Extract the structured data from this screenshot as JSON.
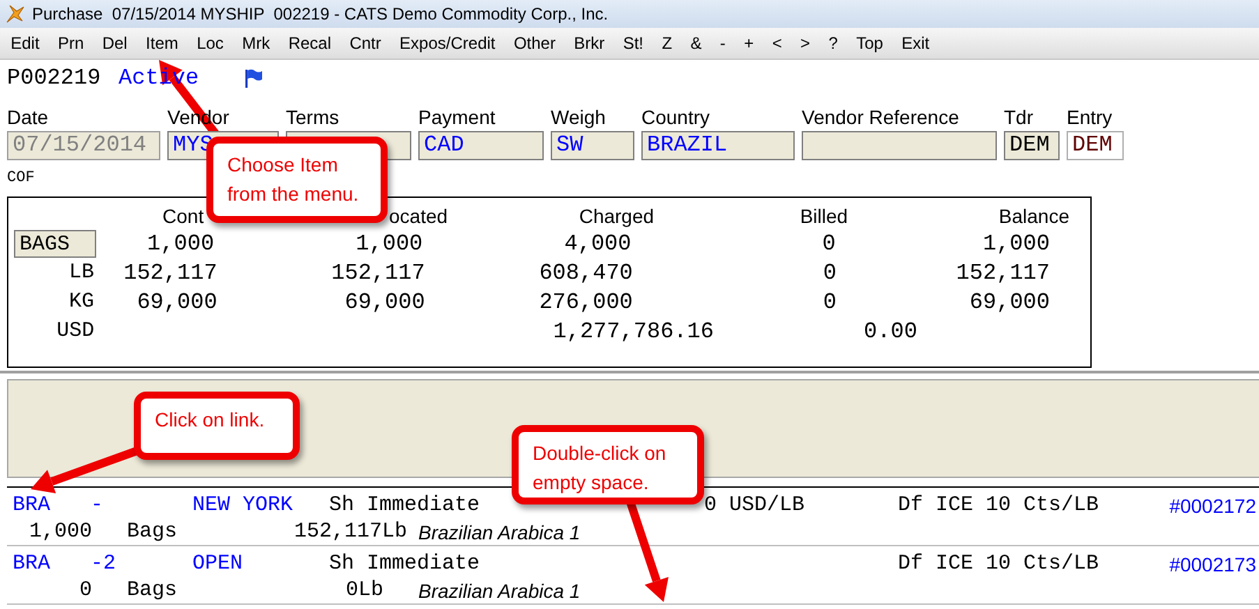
{
  "window": {
    "title": "Purchase  07/15/2014 MYSHIP  002219 - CATS Demo Commodity Corp., Inc."
  },
  "menu": [
    "Edit",
    "Prn",
    "Del",
    "Item",
    "Loc",
    "Mrk",
    "Recal",
    "Cntr",
    "Expos/Credit",
    "Other",
    "Brkr",
    "St!",
    "Z",
    "&",
    "-",
    "+",
    "<",
    ">",
    "?",
    "Top",
    "Exit"
  ],
  "header": {
    "id": "P002219",
    "status": "Active"
  },
  "fields": [
    {
      "label": "Date",
      "value": "07/15/2014",
      "kind": "disabled"
    },
    {
      "label": "Vendor",
      "value": "MYS",
      "kind": "lookup"
    },
    {
      "label": "Terms",
      "kind": "readonly"
    },
    {
      "label": "Payment",
      "value": "CAD",
      "kind": "lookup"
    },
    {
      "label": "Weigh",
      "value": "SW",
      "kind": "lookup"
    },
    {
      "label": "Country",
      "value": "BRAZIL",
      "kind": "lookup"
    },
    {
      "label": "Vendor Reference",
      "kind": "readonly"
    },
    {
      "label": "Tdr",
      "value": "DEM",
      "kind": "readonly"
    },
    {
      "label": "Entry",
      "value": "DEM",
      "kind": "editable"
    }
  ],
  "commodity": "COF",
  "summary": {
    "columns": [
      "Cont",
      "ocated",
      "Charged",
      "Billed",
      "Balance"
    ],
    "rows": [
      {
        "unit": "BAGS",
        "kind": "field",
        "values": {
          "column_1": "1,000",
          "column_2": "1,000",
          "column_3": "4,000",
          "column_4": "0",
          "column_5": "1,000"
        }
      },
      {
        "unit": "LB",
        "kind": "text",
        "values": {
          "column_1": "152,117",
          "column_2": "152,117",
          "column_3": "608,470",
          "column_4": "0",
          "column_5": "152,117"
        }
      },
      {
        "unit": "KG",
        "kind": "text",
        "values": {
          "column_1": "69,000",
          "column_2": "69,000",
          "column_3": "276,000",
          "column_4": "0",
          "column_5": "69,000"
        }
      },
      {
        "unit": "USD",
        "kind": "text",
        "values": {
          "column_3": "1,277,786.16",
          "column_4": "0.00"
        }
      }
    ]
  },
  "items": [
    {
      "grade": "BRA",
      "suffix": "-",
      "location": "NEW YORK",
      "ship": "Sh",
      "timing": "Immediate",
      "price": "0 USD/LB",
      "futures": "Df ICE 10 Cts/LB",
      "number": "#0002172",
      "quantity": "1,000",
      "unit": "Bags",
      "weight": "152,117Lb",
      "description": "Brazilian Arabica 1"
    },
    {
      "grade": "BRA",
      "suffix": "-2",
      "location": "OPEN",
      "ship": "Sh",
      "timing": "Immediate",
      "futures": "Df ICE 10 Cts/LB",
      "number": "#0002173",
      "quantity": "0",
      "unit": "Bags",
      "weight": "0Lb",
      "description": "Brazilian Arabica 1"
    }
  ],
  "callouts": [
    {
      "text": "Choose Item from the menu."
    },
    {
      "text": "Click on link."
    },
    {
      "text": "Double-click on empty space."
    }
  ]
}
